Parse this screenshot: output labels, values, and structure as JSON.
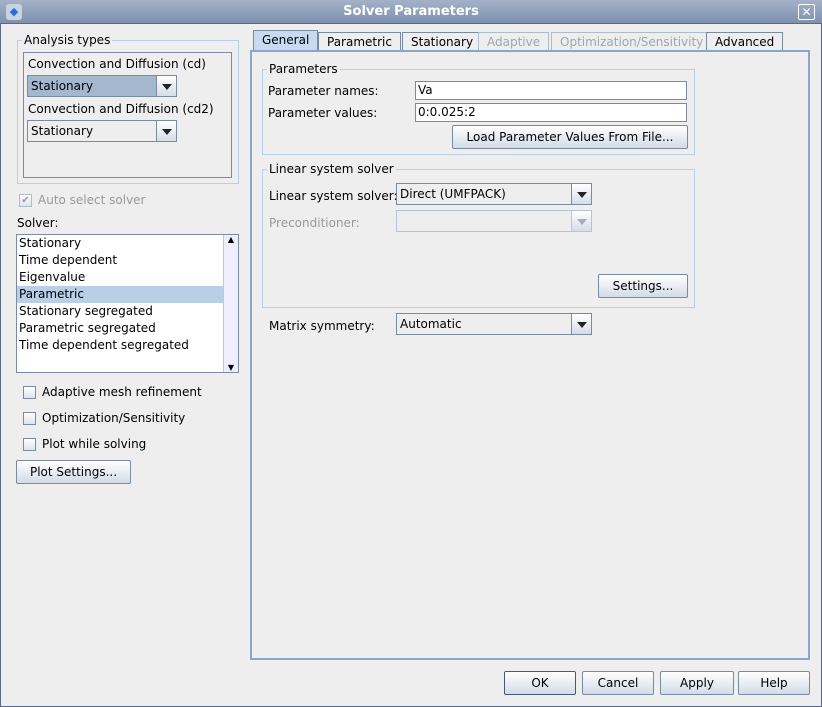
{
  "window": {
    "title": "Solver Parameters",
    "close": "✕"
  },
  "analysis": {
    "legend": "Analysis types",
    "items": [
      {
        "label": "Convection and Diffusion (cd)",
        "value": "Stationary"
      },
      {
        "label": "Convection and Diffusion (cd2)",
        "value": "Stationary"
      }
    ]
  },
  "auto_select": {
    "label": "Auto select solver",
    "checked": true
  },
  "solver": {
    "label": "Solver:",
    "items": [
      "Stationary",
      "Time dependent",
      "Eigenvalue",
      "Parametric",
      "Stationary segregated",
      "Parametric segregated",
      "Time dependent segregated"
    ],
    "selected": "Parametric"
  },
  "options": [
    {
      "label": "Adaptive mesh refinement",
      "checked": false
    },
    {
      "label": "Optimization/Sensitivity",
      "checked": false
    },
    {
      "label": "Plot while solving",
      "checked": false
    }
  ],
  "plot_settings": "Plot Settings...",
  "tabs": [
    "General",
    "Parametric",
    "Stationary",
    "Adaptive",
    "Optimization/Sensitivity",
    "Advanced"
  ],
  "general": {
    "parameters": {
      "legend": "Parameters",
      "names_label": "Parameter names:",
      "names_value": "Va",
      "values_label": "Parameter values:",
      "values_value": "0:0.025:2",
      "load_button": "Load Parameter Values From File..."
    },
    "linear": {
      "legend": "Linear system solver",
      "solver_label": "Linear system solver:",
      "solver_value": "Direct (UMFPACK)",
      "precond_label": "Preconditioner:",
      "precond_value": "",
      "settings_button": "Settings..."
    },
    "matrix": {
      "label": "Matrix symmetry:",
      "value": "Automatic"
    }
  },
  "footer": {
    "ok": "OK",
    "cancel": "Cancel",
    "apply": "Apply",
    "help": "Help"
  }
}
